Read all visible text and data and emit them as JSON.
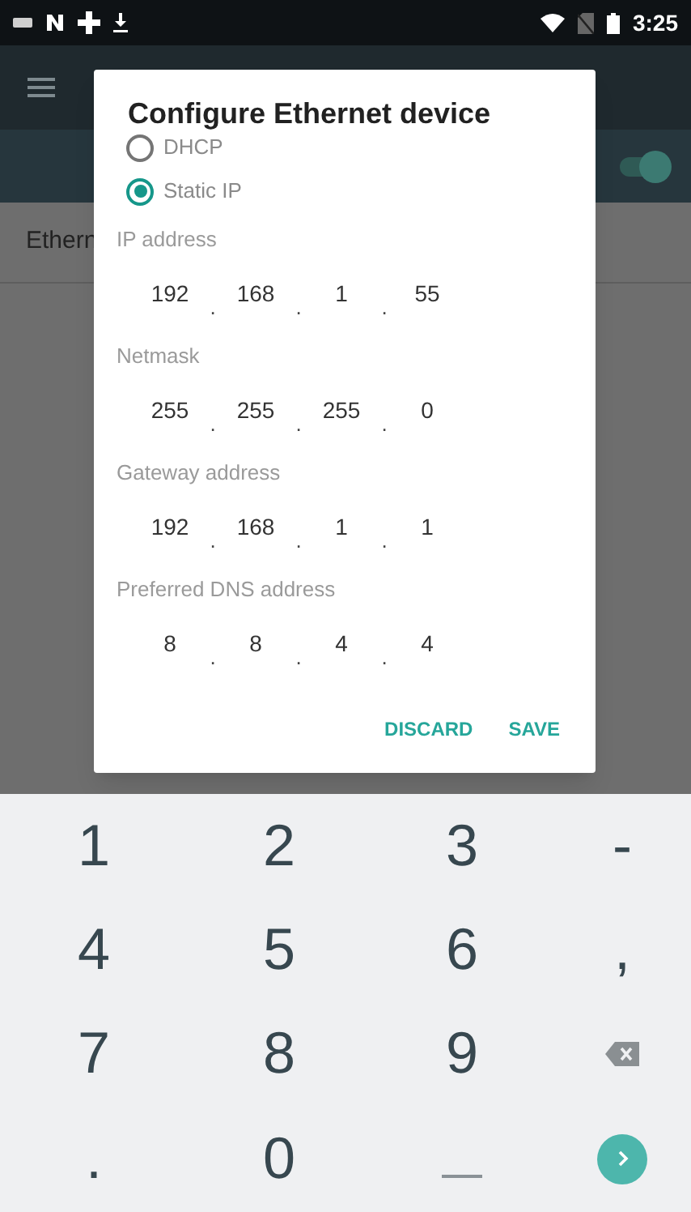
{
  "status_bar": {
    "time": "3:25"
  },
  "background": {
    "list_item": "Ethern",
    "ethernet_switch": {
      "on": true
    }
  },
  "dialog": {
    "title": "Configure Ethernet device",
    "options": [
      {
        "label": "DHCP",
        "selected": false
      },
      {
        "label": "Static IP",
        "selected": true
      }
    ],
    "fields": [
      {
        "label": "IP address",
        "octets": [
          "192",
          "168",
          "1",
          "55"
        ]
      },
      {
        "label": "Netmask",
        "octets": [
          "255",
          "255",
          "255",
          "0"
        ]
      },
      {
        "label": "Gateway address",
        "octets": [
          "192",
          "168",
          "1",
          "1"
        ]
      },
      {
        "label": "Preferred DNS address",
        "octets": [
          "8",
          "8",
          "4",
          "4"
        ]
      }
    ],
    "separator": ".",
    "buttons": [
      "DISCARD",
      "SAVE"
    ]
  },
  "keyboard": {
    "keys": [
      {
        "kind": "char",
        "label": "1"
      },
      {
        "kind": "char",
        "label": "2"
      },
      {
        "kind": "char",
        "label": "3"
      },
      {
        "kind": "char",
        "label": "-"
      },
      {
        "kind": "char",
        "label": "4"
      },
      {
        "kind": "char",
        "label": "5"
      },
      {
        "kind": "char",
        "label": "6"
      },
      {
        "kind": "char",
        "label": ","
      },
      {
        "kind": "char",
        "label": "7"
      },
      {
        "kind": "char",
        "label": "8"
      },
      {
        "kind": "char",
        "label": "9"
      },
      {
        "kind": "backspace"
      },
      {
        "kind": "char",
        "label": "."
      },
      {
        "kind": "char",
        "label": "0"
      },
      {
        "kind": "space"
      },
      {
        "kind": "go"
      }
    ]
  }
}
